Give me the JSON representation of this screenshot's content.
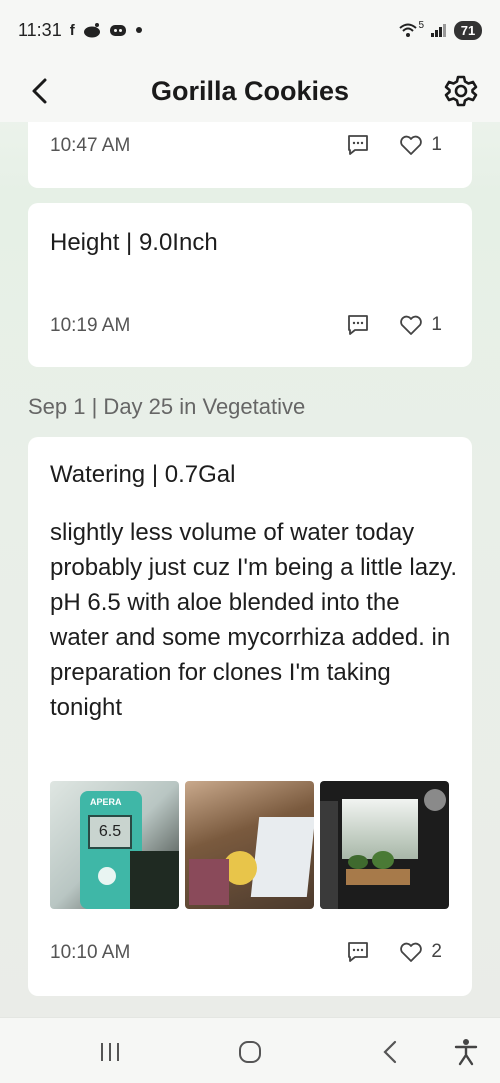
{
  "status_bar": {
    "time": "11:31",
    "notification_icons": [
      "facebook-icon",
      "reddit-icon",
      "discord-icon",
      "dot-icon"
    ],
    "wifi_label": "5",
    "battery": "71"
  },
  "header": {
    "title": "Gorilla Cookies",
    "back_icon": "chevron-left-icon",
    "settings_icon": "gear-icon"
  },
  "entries": [
    {
      "time": "10:47 AM",
      "likes": "1"
    },
    {
      "title": "Height | 9.0Inch",
      "time": "10:19 AM",
      "likes": "1"
    }
  ],
  "section": {
    "label": "Sep 1 | Day 25 in Vegetative"
  },
  "watering_entry": {
    "title": "Watering | 0.7Gal",
    "body": "slightly less volume of water today probably just cuz I'm being a little lazy. pH 6.5 with aloe blended into the water and some mycorrhiza added. in preparation for clones I'm taking tonight",
    "photo_meter_brand": "APERA",
    "photo_meter_reading": "6.5",
    "time": "10:10 AM",
    "likes": "2"
  },
  "nav": [
    "recents-icon",
    "home-icon",
    "back-icon",
    "accessibility-icon"
  ]
}
